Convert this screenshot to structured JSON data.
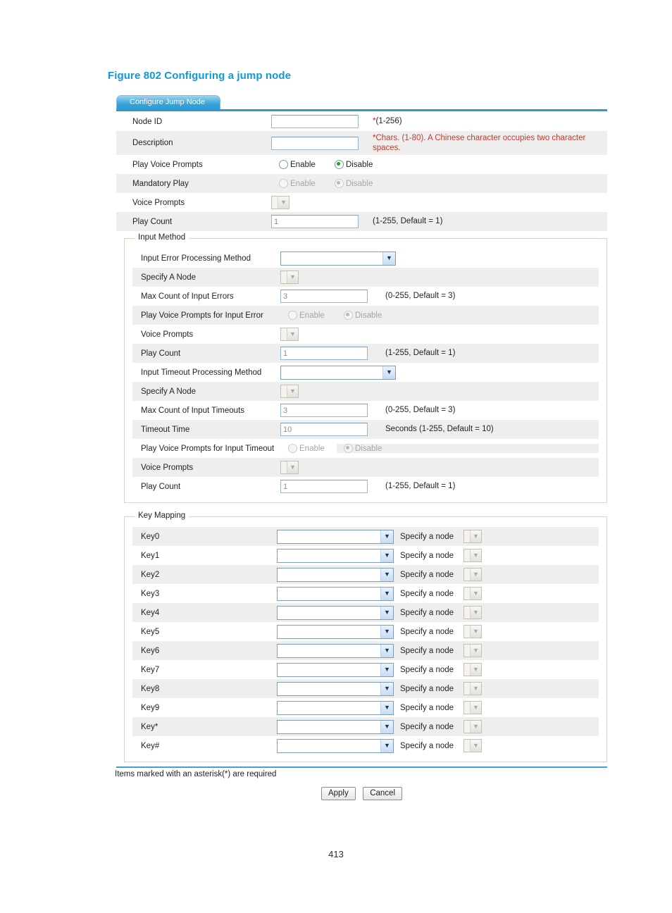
{
  "figure": {
    "caption": "Figure 802 Configuring a jump node",
    "accent": "#0f9ad7"
  },
  "tab": {
    "label": "Configure Jump Node"
  },
  "top_form": {
    "rows": [
      {
        "label": "Node ID",
        "control": "text",
        "value": "",
        "hint": "(1-256)",
        "required": true
      },
      {
        "label": "Description",
        "control": "text",
        "value": "",
        "hint": "Chars. (1-80). A Chinese character occupies two character spaces.",
        "required": true
      },
      {
        "label": "Play Voice Prompts",
        "control": "radio",
        "options": [
          "Enable",
          "Disable"
        ],
        "selected": "Disable",
        "disabled": false
      },
      {
        "label": "Mandatory Play",
        "control": "radio",
        "options": [
          "Enable",
          "Disable"
        ],
        "selected": "Disable",
        "disabled": true
      },
      {
        "label": "Voice Prompts",
        "control": "select-small",
        "value": "",
        "disabled": true
      },
      {
        "label": "Play Count",
        "control": "text",
        "value": "1",
        "hint": "(1-255, Default = 1)",
        "disabled": true
      }
    ]
  },
  "input_method": {
    "legend": "Input Method",
    "rows": [
      {
        "label": "Input Error Processing Method",
        "control": "select",
        "value": "",
        "disabled": false
      },
      {
        "label": "Specify A Node",
        "control": "select-small",
        "value": "",
        "disabled": true
      },
      {
        "label": "Max Count of Input Errors",
        "control": "text",
        "value": "3",
        "hint": "(0-255, Default = 3)",
        "disabled": true
      },
      {
        "label": "Play Voice Prompts for Input Error",
        "control": "radio",
        "options": [
          "Enable",
          "Disable"
        ],
        "selected": "Disable",
        "disabled": true
      },
      {
        "label": "Voice Prompts",
        "control": "select-small",
        "value": "",
        "disabled": true
      },
      {
        "label": "Play Count",
        "control": "text",
        "value": "1",
        "hint": "(1-255, Default = 1)",
        "disabled": true
      },
      {
        "label": "Input Timeout Processing Method",
        "control": "select",
        "value": "",
        "disabled": false
      },
      {
        "label": "Specify A Node",
        "control": "select-small",
        "value": "",
        "disabled": true
      },
      {
        "label": "Max Count of Input Timeouts",
        "control": "text",
        "value": "3",
        "hint": "(0-255, Default = 3)",
        "disabled": true
      },
      {
        "label": "Timeout Time",
        "control": "text",
        "value": "10",
        "hint": "Seconds (1-255, Default = 10)",
        "disabled": true
      },
      {
        "label": "Play Voice Prompts for Input Timeout",
        "control": "radio",
        "options": [
          "Enable",
          "Disable"
        ],
        "selected": "Disable",
        "disabled": true
      },
      {
        "label": "Voice Prompts",
        "control": "select-small",
        "value": "",
        "disabled": true
      },
      {
        "label": "Play Count",
        "control": "text",
        "value": "1",
        "hint": "(1-255, Default = 1)",
        "disabled": true
      }
    ]
  },
  "key_mapping": {
    "legend": "Key Mapping",
    "specify_label": "Specify a node",
    "rows": [
      {
        "label": "Key0",
        "action": "",
        "node": ""
      },
      {
        "label": "Key1",
        "action": "",
        "node": ""
      },
      {
        "label": "Key2",
        "action": "",
        "node": ""
      },
      {
        "label": "Key3",
        "action": "",
        "node": ""
      },
      {
        "label": "Key4",
        "action": "",
        "node": ""
      },
      {
        "label": "Key5",
        "action": "",
        "node": ""
      },
      {
        "label": "Key6",
        "action": "",
        "node": ""
      },
      {
        "label": "Key7",
        "action": "",
        "node": ""
      },
      {
        "label": "Key8",
        "action": "",
        "node": ""
      },
      {
        "label": "Key9",
        "action": "",
        "node": ""
      },
      {
        "label": "Key*",
        "action": "",
        "node": ""
      },
      {
        "label": "Key#",
        "action": "",
        "node": ""
      }
    ]
  },
  "footer": {
    "required_note": "Items marked with an asterisk(*) are required",
    "apply_label": "Apply",
    "cancel_label": "Cancel"
  },
  "page_number": "413"
}
